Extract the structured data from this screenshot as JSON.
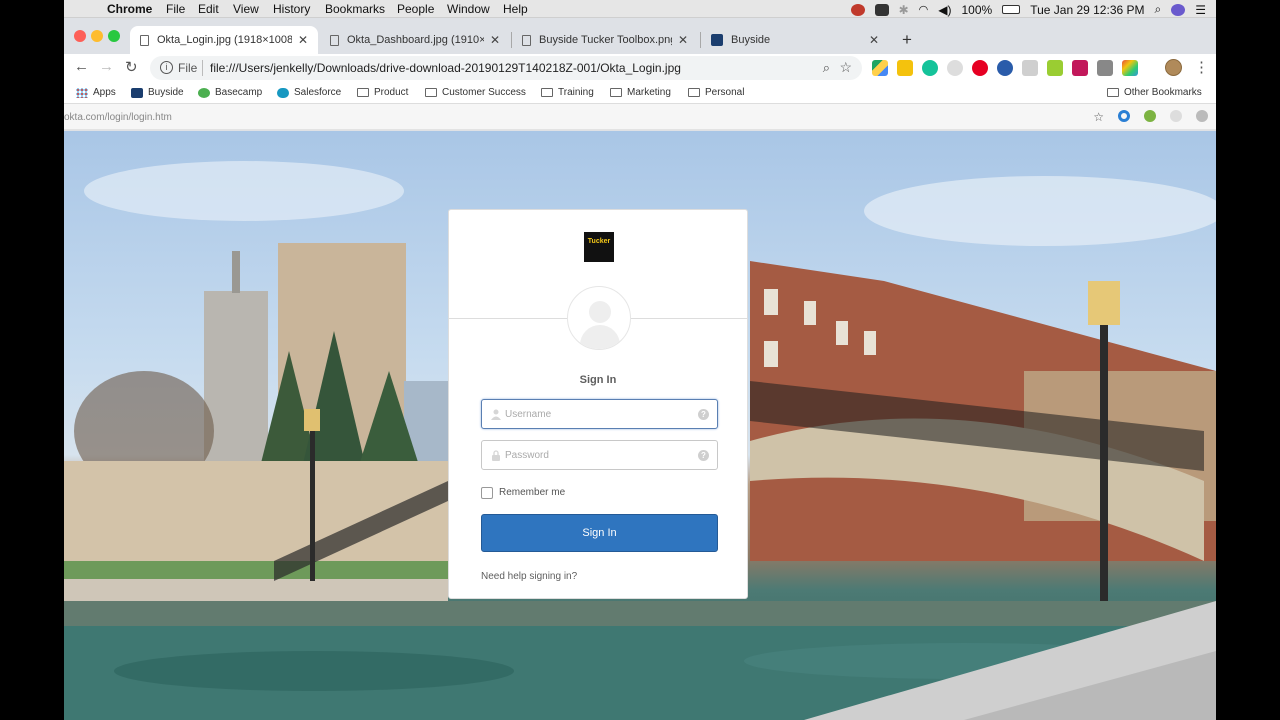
{
  "menubar": {
    "app": "Chrome",
    "items": [
      "File",
      "Edit",
      "View",
      "History",
      "Bookmarks",
      "People",
      "Window",
      "Help"
    ],
    "battery": "100%",
    "datetime": "Tue Jan 29  12:36 PM"
  },
  "tabs": [
    {
      "title": "Okta_Login.jpg (1918×1008)",
      "active": true
    },
    {
      "title": "Okta_Dashboard.jpg (1910×100",
      "active": false
    },
    {
      "title": "Buyside Tucker Toolbox.png (1",
      "active": false
    },
    {
      "title": "Buyside",
      "active": false
    }
  ],
  "toolbar": {
    "scheme": "File",
    "url": "file:///Users/jenkelly/Downloads/drive-download-20190129T140218Z-001/Okta_Login.jpg"
  },
  "bookmarks": {
    "items": [
      "Apps",
      "Buyside",
      "Basecamp",
      "Salesforce",
      "Product",
      "Customer Success",
      "Training",
      "Marketing",
      "Personal"
    ],
    "other": "Other Bookmarks"
  },
  "status": {
    "url": "okta.com/login/login.htm"
  },
  "login": {
    "logo_text": "Tucker",
    "title": "Sign In",
    "username_placeholder": "Username",
    "password_placeholder": "Password",
    "remember_label": "Remember me",
    "button_label": "Sign In",
    "help_link": "Need help signing in?"
  },
  "colors": {
    "primary_button": "#2f75bf",
    "focus_border": "#5a7fb2"
  }
}
